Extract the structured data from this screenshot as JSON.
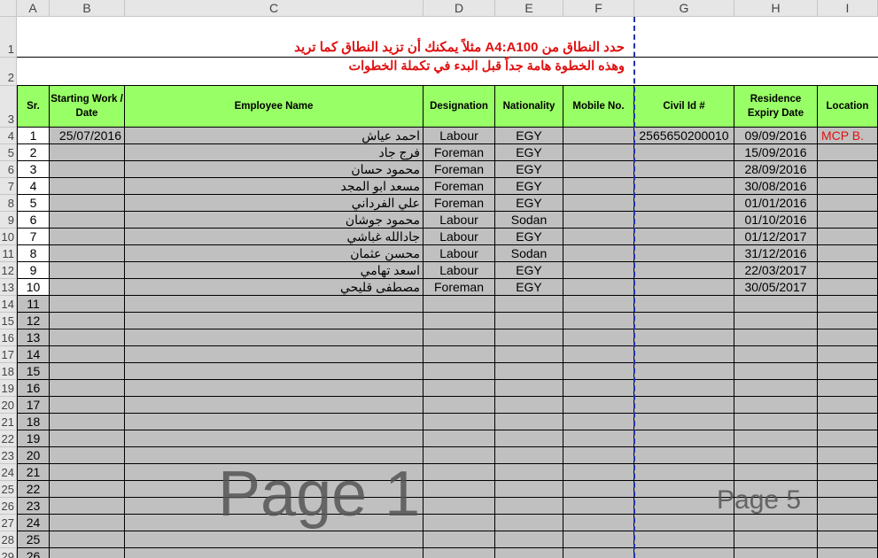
{
  "columns": [
    "A",
    "B",
    "C",
    "D",
    "E",
    "F",
    "G",
    "H",
    "I"
  ],
  "note": {
    "line1": "حدد النطاق من A4:A100 مثلاً يمكنك أن تزيد النطاق كما تريد",
    "line2": "وهذه الخطوة هامة جداً قبل البدء في تكملة الخطوات"
  },
  "headers": {
    "sr": "Sr.",
    "start": "Starting Work / Date",
    "name": "Employee Name",
    "designation": "Designation",
    "nationality": "Nationality",
    "mobile": "Mobile No.",
    "civil": "Civil Id #",
    "residence": "Residence Expiry Date",
    "location": "Location"
  },
  "employees": [
    {
      "sr": "1",
      "start": "25/07/2016",
      "name": "احمد عياش",
      "designation": "Labour",
      "nationality": "EGY",
      "mobile": "",
      "civil": "2565650200010",
      "residence": "09/09/2016",
      "location": "MCP B."
    },
    {
      "sr": "2",
      "start": "",
      "name": "فرج جاد",
      "designation": "Foreman",
      "nationality": "EGY",
      "mobile": "",
      "civil": "",
      "residence": "15/09/2016",
      "location": ""
    },
    {
      "sr": "3",
      "start": "",
      "name": "محمود حسان",
      "designation": "Foreman",
      "nationality": "EGY",
      "mobile": "",
      "civil": "",
      "residence": "28/09/2016",
      "location": ""
    },
    {
      "sr": "4",
      "start": "",
      "name": "مسعد ابو المجد",
      "designation": "Foreman",
      "nationality": "EGY",
      "mobile": "",
      "civil": "",
      "residence": "30/08/2016",
      "location": ""
    },
    {
      "sr": "5",
      "start": "",
      "name": "علي الفرداني",
      "designation": "Foreman",
      "nationality": "EGY",
      "mobile": "",
      "civil": "",
      "residence": "01/01/2016",
      "location": ""
    },
    {
      "sr": "6",
      "start": "",
      "name": "محمود جوشان",
      "designation": "Labour",
      "nationality": "Sodan",
      "mobile": "",
      "civil": "",
      "residence": "01/10/2016",
      "location": ""
    },
    {
      "sr": "7",
      "start": "",
      "name": "جادالله غباشي",
      "designation": "Labour",
      "nationality": "EGY",
      "mobile": "",
      "civil": "",
      "residence": "01/12/2017",
      "location": ""
    },
    {
      "sr": "8",
      "start": "",
      "name": "محسن عثمان",
      "designation": "Labour",
      "nationality": "Sodan",
      "mobile": "",
      "civil": "",
      "residence": "31/12/2016",
      "location": ""
    },
    {
      "sr": "9",
      "start": "",
      "name": "اسعد تهامي",
      "designation": "Labour",
      "nationality": "EGY",
      "mobile": "",
      "civil": "",
      "residence": "22/03/2017",
      "location": ""
    },
    {
      "sr": "10",
      "start": "",
      "name": "مصطفى قليحي",
      "designation": "Foreman",
      "nationality": "EGY",
      "mobile": "",
      "civil": "",
      "residence": "30/05/2017",
      "location": ""
    }
  ],
  "extra_sr": [
    "11",
    "12",
    "13",
    "14",
    "15",
    "16",
    "17",
    "18",
    "19",
    "20",
    "21",
    "22",
    "23",
    "24",
    "25",
    "26"
  ],
  "row_numbers": [
    "1",
    "2",
    "3",
    "4",
    "5",
    "6",
    "7",
    "8",
    "9",
    "10",
    "11",
    "12",
    "13",
    "14",
    "15",
    "16",
    "17",
    "18",
    "19",
    "20",
    "21",
    "22",
    "23",
    "24",
    "25",
    "26",
    "27",
    "28",
    "29"
  ],
  "watermarks": {
    "left": "Page 1",
    "right": "Page 5"
  },
  "colors": {
    "accent_red": "#e01010",
    "header_green": "#99ff66",
    "page_break": "#2233aa"
  }
}
